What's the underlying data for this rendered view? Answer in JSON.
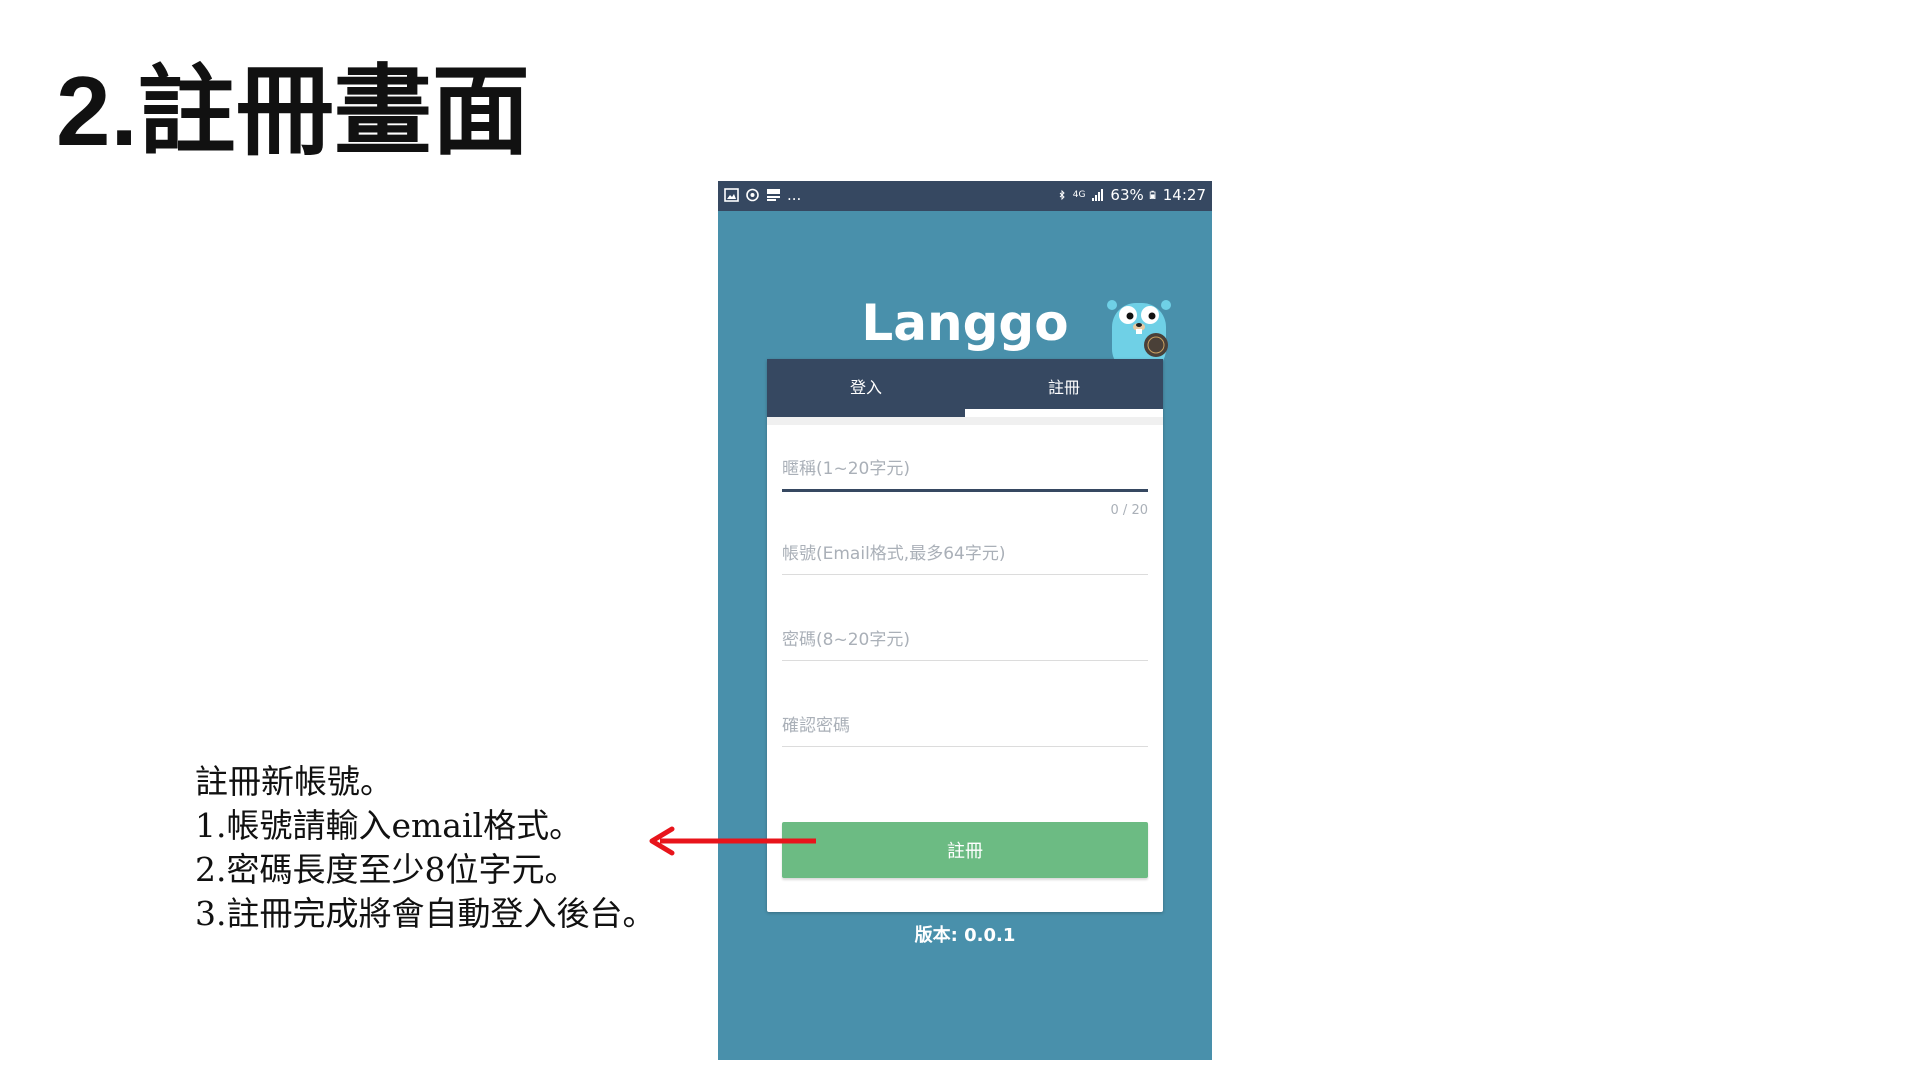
{
  "slide": {
    "title": "2.註冊畫面"
  },
  "statusbar": {
    "left_overflow": "...",
    "network": "4G",
    "battery": "63%",
    "time": "14:27"
  },
  "app": {
    "title": "Langgo",
    "tabs": [
      {
        "label": "登入",
        "active": false
      },
      {
        "label": "註冊",
        "active": true
      }
    ],
    "fields": {
      "nickname": {
        "placeholder": "暱稱(1~20字元)",
        "value": "",
        "counter": "0 / 20"
      },
      "account": {
        "placeholder": "帳號(Email格式,最多64字元)",
        "value": ""
      },
      "password": {
        "placeholder": "密碼(8~20字元)",
        "value": ""
      },
      "confirm": {
        "placeholder": "確認密碼",
        "value": ""
      }
    },
    "submit_label": "註冊",
    "version": "版本: 0.0.1"
  },
  "notes": [
    "註冊新帳號。",
    "1.帳號請輸入email格式。",
    "2.密碼長度至少8位字元。",
    "3.註冊完成將會自動登入後台。"
  ],
  "colors": {
    "statusbar": "#364861",
    "phone_bg": "#4990ab",
    "tab_bar": "#364861",
    "submit": "#6cbb83",
    "arrow": "#e8141b"
  },
  "icons": [
    "image-icon",
    "sync-icon",
    "notification-icon",
    "bluetooth-icon",
    "signal-icon",
    "battery-icon",
    "gopher-mascot-icon",
    "arrow-left-icon"
  ]
}
